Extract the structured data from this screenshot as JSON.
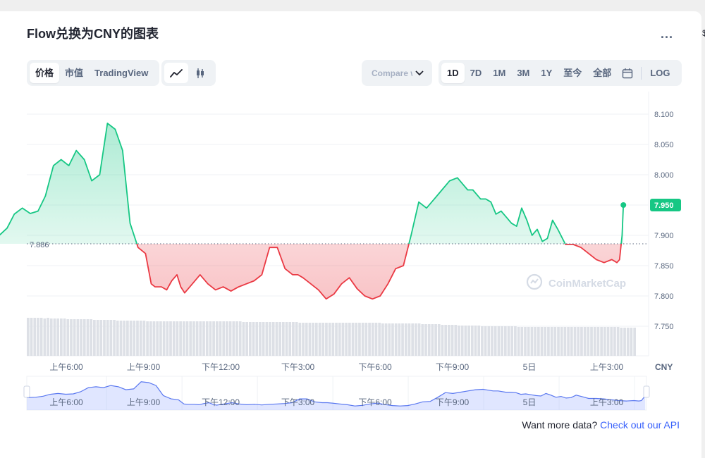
{
  "title": "Flow兑换为CNY的图表",
  "more_label": "...",
  "edge_mark": "$",
  "view_tabs": [
    {
      "label": "价格",
      "active": true
    },
    {
      "label": "市值",
      "active": false
    },
    {
      "label": "TradingView",
      "active": false
    }
  ],
  "chart_type_buttons": [
    {
      "icon": "line-chart-icon",
      "active": true
    },
    {
      "icon": "candlestick-icon",
      "active": false
    }
  ],
  "compare": {
    "label": "Compare with"
  },
  "time_ranges": [
    {
      "label": "1D",
      "active": true
    },
    {
      "label": "7D",
      "active": false
    },
    {
      "label": "1M",
      "active": false
    },
    {
      "label": "3M",
      "active": false
    },
    {
      "label": "1Y",
      "active": false
    },
    {
      "label": "至今",
      "active": false
    },
    {
      "label": "全部",
      "active": false
    }
  ],
  "calendar_icon": "calendar-icon",
  "log_label": "LOG",
  "watermark": "CoinMarketCap",
  "footer": {
    "text": "Want more data?",
    "link": "Check out our API"
  },
  "colors": {
    "up": "#16c784",
    "down": "#ea3943",
    "accent": "#3861fb",
    "nav": "#a6b7ff"
  },
  "chart_data": {
    "type": "line",
    "title": "Flow兑换为CNY的图表",
    "currency": "CNY",
    "ylim": [
      7.7,
      8.12
    ],
    "yticks": [
      7.75,
      7.8,
      7.85,
      7.9,
      7.95,
      8.0,
      8.05,
      8.1
    ],
    "ytick_labels": [
      "7.750",
      "7.800",
      "7.850",
      "7.900",
      "7.950",
      "8.000",
      "8.050",
      "8.100"
    ],
    "reference_price": 7.886,
    "reference_label": "7.886",
    "current_price": 7.95,
    "current_label": "7.950",
    "xlabels": [
      "上午6:00",
      "上午9:00",
      "下午12:00",
      "下午3:00",
      "下午6:00",
      "下午9:00",
      "5日",
      "上午3:00"
    ],
    "xlabel_hours": [
      6,
      9,
      12,
      15,
      18,
      21,
      24,
      27
    ],
    "x_start_hour": 3.05,
    "x_end_hour": 27.7,
    "series": [
      {
        "x": [
          3.05,
          3.4,
          3.7,
          3.98,
          4.29,
          4.6,
          4.9,
          5.19,
          5.5,
          5.8,
          6.1,
          6.39,
          6.7,
          6.99,
          7.3,
          7.6,
          7.9,
          8.19,
          8.48,
          8.79,
          9.08,
          9.3,
          9.45,
          9.7,
          9.9,
          10.1,
          10.3,
          10.45,
          10.6,
          10.9,
          11.2,
          11.5,
          11.8,
          12.1,
          12.4,
          12.7,
          13.0,
          13.3,
          13.6,
          13.9,
          14.2,
          14.5,
          14.8,
          15.0,
          15.2,
          15.5,
          15.8,
          16.1,
          16.4,
          16.7,
          17.0,
          17.3,
          17.6,
          17.9,
          18.2,
          18.5,
          18.8,
          19.1,
          19.4,
          19.7,
          20.0,
          20.3,
          20.6,
          20.9,
          21.2,
          21.4,
          21.6,
          21.8,
          22.1,
          22.3,
          22.5,
          22.7,
          22.9,
          23.1,
          23.3,
          23.5,
          23.7,
          23.9,
          24.1,
          24.3,
          24.5,
          24.7,
          24.9,
          25.1,
          25.4,
          25.7,
          26.0,
          26.3,
          26.6,
          26.9,
          27.2,
          27.4,
          27.5,
          27.6,
          27.65
        ],
        "y": [
          7.895,
          7.9,
          7.912,
          7.935,
          7.945,
          7.936,
          7.94,
          7.965,
          8.015,
          8.025,
          8.015,
          8.04,
          8.025,
          7.99,
          8.0,
          8.085,
          8.075,
          8.04,
          7.92,
          7.88,
          7.87,
          7.82,
          7.815,
          7.815,
          7.81,
          7.825,
          7.835,
          7.815,
          7.805,
          7.82,
          7.835,
          7.82,
          7.81,
          7.815,
          7.808,
          7.815,
          7.82,
          7.825,
          7.835,
          7.88,
          7.88,
          7.845,
          7.835,
          7.835,
          7.83,
          7.82,
          7.81,
          7.795,
          7.803,
          7.82,
          7.83,
          7.812,
          7.8,
          7.795,
          7.8,
          7.82,
          7.845,
          7.85,
          7.9,
          7.955,
          7.945,
          7.96,
          7.975,
          7.99,
          7.995,
          7.985,
          7.975,
          7.975,
          7.96,
          7.96,
          7.955,
          7.935,
          7.94,
          7.93,
          7.92,
          7.915,
          7.945,
          7.925,
          7.9,
          7.91,
          7.89,
          7.895,
          7.925,
          7.91,
          7.885,
          7.885,
          7.88,
          7.87,
          7.86,
          7.855,
          7.86,
          7.855,
          7.86,
          7.9,
          7.95
        ]
      }
    ],
    "volume_bars": [
      40,
      40,
      40,
      40,
      40,
      39,
      40,
      39,
      39,
      39,
      39,
      39,
      38,
      38,
      38,
      38,
      38,
      38,
      38,
      38,
      37,
      37,
      37,
      37,
      37,
      37,
      37,
      36,
      36,
      36,
      36,
      36,
      36,
      36,
      36,
      36,
      35,
      35,
      35,
      35,
      35,
      35,
      35,
      35,
      35,
      35,
      35,
      35,
      35,
      35,
      35,
      35,
      35,
      35,
      35,
      35,
      35,
      35,
      35,
      35,
      35,
      35,
      35,
      35,
      35,
      34,
      34,
      34,
      34,
      34,
      34,
      34,
      34,
      34,
      34,
      34,
      34,
      34,
      34,
      34,
      34,
      34,
      33,
      33,
      33,
      33,
      33,
      33,
      33,
      33,
      33,
      33,
      33,
      33,
      33,
      33,
      33,
      33,
      33,
      33,
      33,
      33,
      33,
      33,
      33,
      33,
      33,
      32,
      32,
      32,
      32,
      32,
      32,
      32,
      32,
      32,
      32,
      32,
      32,
      31,
      31,
      31,
      31,
      31,
      31,
      30,
      30,
      30,
      30,
      30,
      29,
      29,
      29,
      29,
      29,
      29,
      29,
      28,
      28,
      28,
      28,
      28,
      28,
      28,
      28,
      28,
      28,
      28,
      27,
      27,
      27,
      27,
      27,
      27,
      27,
      27,
      27,
      27,
      27,
      27,
      27,
      27,
      27,
      27,
      27,
      27,
      27,
      27,
      27,
      27,
      27,
      27,
      27,
      27,
      27,
      27,
      27,
      27,
      27,
      26,
      26,
      26,
      26,
      26
    ]
  }
}
